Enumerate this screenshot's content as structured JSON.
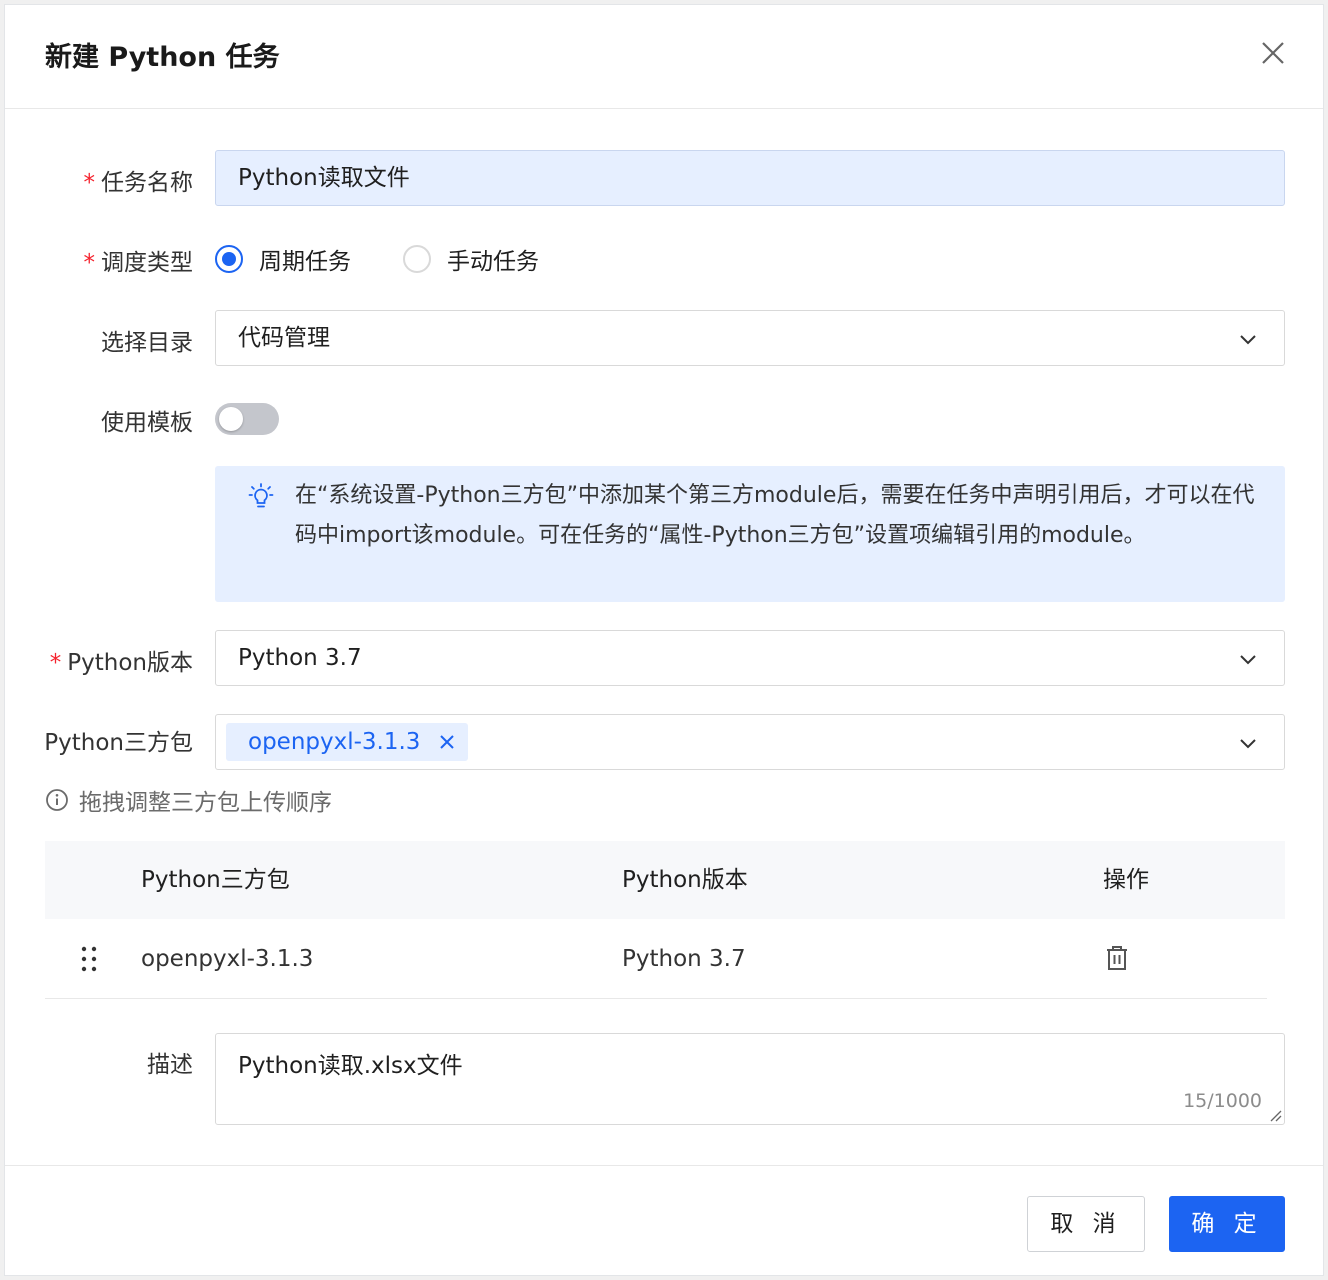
{
  "dialog": {
    "title": "新建 Python 任务"
  },
  "form": {
    "task_name": {
      "label": "任务名称",
      "value": "Python读取文件"
    },
    "schedule_type": {
      "label": "调度类型",
      "options": [
        "周期任务",
        "手动任务"
      ],
      "selected": "周期任务"
    },
    "directory": {
      "label": "选择目录",
      "value": "代码管理"
    },
    "use_template": {
      "label": "使用模板",
      "on": false
    },
    "notice": "在“系统设置-Python三方包”中添加某个第三方module后，需要在任务中声明引用后，才可以在代码中import该module。可在任务的“属性-Python三方包”设置项编辑引用的module。",
    "python_version": {
      "label": "Python版本",
      "value": "Python 3.7"
    },
    "packages": {
      "label": "Python三方包",
      "tags": [
        "openpyxl-3.1.3"
      ]
    },
    "drag_hint": "拖拽调整三方包上传顺序",
    "table": {
      "columns": [
        "Python三方包",
        "Python版本",
        "操作"
      ],
      "rows": [
        {
          "package": "openpyxl-3.1.3",
          "version": "Python 3.7"
        }
      ]
    },
    "description": {
      "label": "描述",
      "value": "Python读取.xlsx文件",
      "count": "15/1000"
    }
  },
  "footer": {
    "cancel": "取 消",
    "ok": "确 定"
  },
  "colors": {
    "primary": "#1c64f2",
    "required": "#f5222d",
    "light_blue": "#e6efff"
  }
}
